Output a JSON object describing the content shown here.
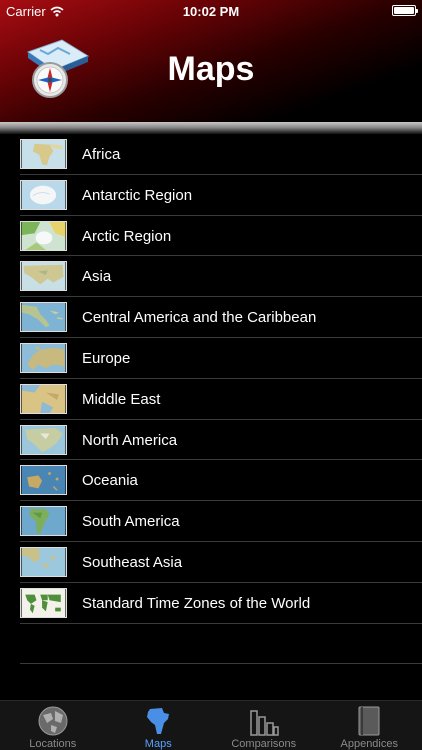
{
  "status_bar": {
    "carrier": "Carrier",
    "time": "10:02 PM"
  },
  "header": {
    "title": "Maps",
    "icon": "map-compass-icon"
  },
  "maps": [
    {
      "label": "Africa",
      "thumb": "africa"
    },
    {
      "label": "Antarctic Region",
      "thumb": "antarctic"
    },
    {
      "label": "Arctic Region",
      "thumb": "arctic"
    },
    {
      "label": "Asia",
      "thumb": "asia"
    },
    {
      "label": "Central America and the Caribbean",
      "thumb": "central-america"
    },
    {
      "label": "Europe",
      "thumb": "europe"
    },
    {
      "label": "Middle East",
      "thumb": "middle-east"
    },
    {
      "label": "North America",
      "thumb": "north-america"
    },
    {
      "label": "Oceania",
      "thumb": "oceania"
    },
    {
      "label": "South America",
      "thumb": "south-america"
    },
    {
      "label": "Southeast Asia",
      "thumb": "southeast-asia"
    },
    {
      "label": "Standard Time Zones of the World",
      "thumb": "time-zones"
    }
  ],
  "tabs": [
    {
      "label": "Locations",
      "icon": "globe-icon",
      "active": false
    },
    {
      "label": "Maps",
      "icon": "africa-icon",
      "active": true
    },
    {
      "label": "Comparisons",
      "icon": "bar-chart-icon",
      "active": false
    },
    {
      "label": "Appendices",
      "icon": "book-icon",
      "active": false
    }
  ],
  "colors": {
    "tab_active": "#5aa0ff",
    "tab_inactive": "#8a8a8a",
    "header_red": "#a80d12"
  }
}
